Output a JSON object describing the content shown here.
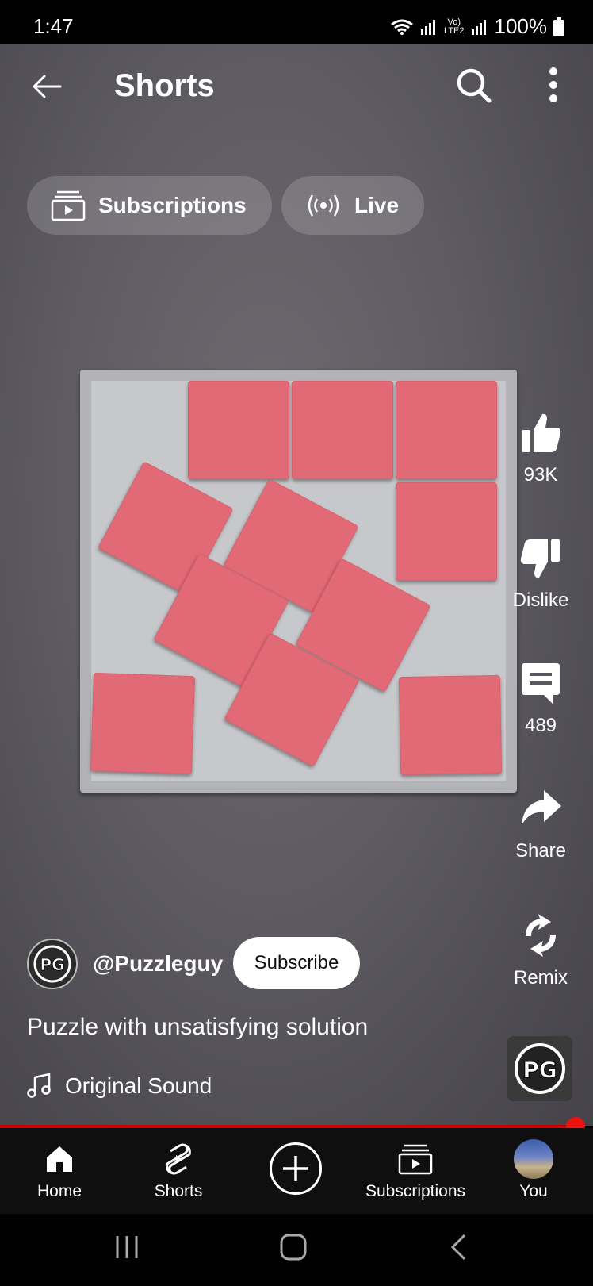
{
  "status_bar": {
    "time": "1:47",
    "network_label_top": "Vo)",
    "network_label_bottom": "LTE2",
    "battery": "100%"
  },
  "header": {
    "title": "Shorts"
  },
  "chips": [
    {
      "label": "Subscriptions",
      "icon": "subscriptions-icon"
    },
    {
      "label": "Live",
      "icon": "live-icon"
    }
  ],
  "actions": {
    "like_count": "93K",
    "dislike_label": "Dislike",
    "comment_count": "489",
    "share_label": "Share",
    "remix_label": "Remix"
  },
  "video": {
    "channel": "@Puzzleguy",
    "subscribe_label": "Subscribe",
    "title": "Puzzle with unsatisfying solution",
    "sound": "Original Sound",
    "avatar_mark": "PG",
    "progress": 0.97
  },
  "bottom_nav": [
    {
      "label": "Home",
      "icon": "home-icon"
    },
    {
      "label": "Shorts",
      "icon": "shorts-icon"
    },
    {
      "label": "",
      "icon": "create-icon"
    },
    {
      "label": "Subscriptions",
      "icon": "subscriptions-icon"
    },
    {
      "label": "You",
      "icon": "avatar"
    }
  ],
  "colors": {
    "accent": "#ff0000",
    "tile": "#e26a76",
    "tray": "#b2b3b6"
  }
}
